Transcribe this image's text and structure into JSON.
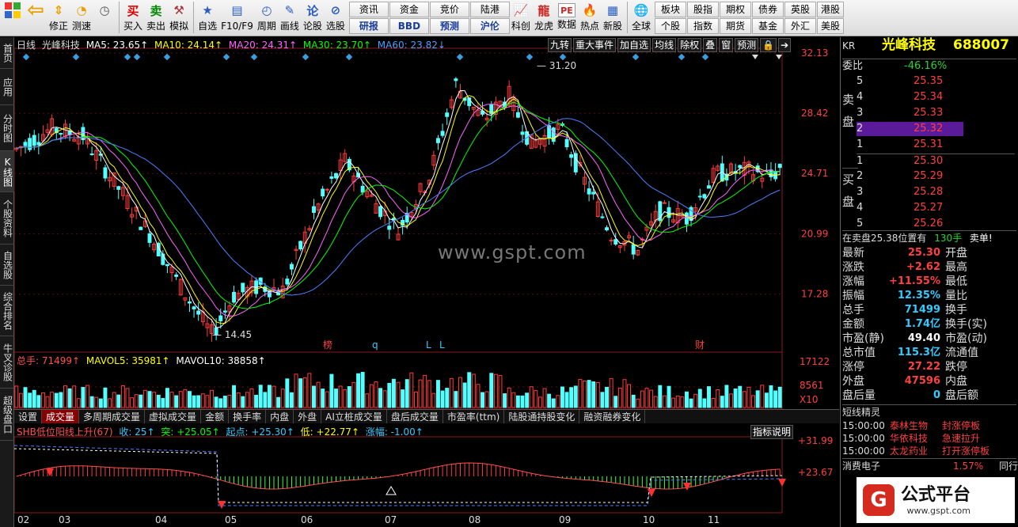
{
  "toolbar": {
    "buttons": [
      {
        "name": "home-icon",
        "label": ""
      },
      {
        "name": "back-arrow-icon",
        "label": ""
      },
      {
        "name": "fix-button",
        "label": "修正"
      },
      {
        "name": "test-speed-button",
        "label": "测速"
      },
      {
        "name": "buy-button",
        "icon": "买",
        "label": "买入"
      },
      {
        "name": "sell-button",
        "icon": "卖",
        "label": "卖出"
      },
      {
        "name": "simulate-button",
        "label": "模拟"
      },
      {
        "name": "watchlist-button",
        "label": "自选"
      },
      {
        "name": "f10-button",
        "label": "F10/F9"
      },
      {
        "name": "period-button",
        "label": "周期"
      },
      {
        "name": "draw-line-button",
        "label": "画线"
      },
      {
        "name": "forum-button",
        "label": "论股"
      },
      {
        "name": "stock-select-button",
        "label": "选股"
      }
    ],
    "grid1": [
      [
        "资讯",
        "研报"
      ],
      [
        "资金",
        "BBD"
      ],
      [
        "竞价",
        "预测"
      ],
      [
        "陆港",
        "沪伦"
      ]
    ],
    "icons2": [
      {
        "name": "kline-icon",
        "label": "科创"
      },
      {
        "name": "dragon-tiger-icon",
        "label": "龙虎"
      },
      {
        "name": "pe-icon",
        "icon": "PE",
        "label": "数据"
      },
      {
        "name": "hot-icon",
        "label": "热点"
      },
      {
        "name": "new-stock-icon",
        "label": "新股"
      },
      {
        "name": "globe-icon",
        "label": "全球"
      }
    ],
    "grid2": [
      [
        "板块",
        "个股"
      ],
      [
        "股指",
        "指数"
      ],
      [
        "期权",
        "期货"
      ],
      [
        "债券",
        "基金"
      ],
      [
        "英股",
        "外汇"
      ],
      [
        "港股",
        "美股"
      ]
    ]
  },
  "sidebar": [
    "首页",
    "应用",
    "分时图",
    "K线图",
    "个股资料",
    "自选股",
    "综合排名",
    "牛叉诊股",
    "超级盘口"
  ],
  "chart": {
    "header": {
      "period": "日线",
      "name": "光峰科技",
      "ma5": "MA5: 23.65↑",
      "ma10": "MA10: 24.14↑",
      "ma20": "MA20: 24.31↑",
      "ma30": "MA30: 23.70↑",
      "ma60": "MA60: 23.82↓"
    },
    "topbuttons": [
      "九转",
      "重大事件",
      "加自选",
      "均线",
      "除权",
      "叠",
      "窗",
      "预测"
    ],
    "price_axis": [
      "32.13",
      "28.42",
      "24.71",
      "20.99",
      "17.28"
    ],
    "high_label": "31.20",
    "low_label": "14.45",
    "event_marks": [
      "榜",
      "q",
      "L",
      "L",
      "财"
    ],
    "vol_header": {
      "total": "总手: 71499↑",
      "mavol5": "MAVOL5: 35981↑",
      "mavol10": "MAVOL10: 38858↑"
    },
    "vol_axis": [
      "17122",
      "8561",
      "X10"
    ],
    "subtabs": [
      "设置",
      "成交量",
      "多周期成交量",
      "虚拟成交量",
      "金额",
      "换手率",
      "内盘",
      "外盘",
      "AI立桩成交量",
      "盘后成交量",
      "市盈率(ttm)",
      "陆股通持股变化",
      "融资融券变化"
    ],
    "ind_header": {
      "name": "SHB低位阳线上升(67)",
      "shou": "收: 25↑",
      "tu": "突: +25.05↑",
      "qidian": "起点: +25.30↑",
      "di": "低: +22.77↑",
      "zhangfu": "涨幅: -1.00↑"
    },
    "ind_button": "指标说明",
    "ind_axis": [
      "+31.99",
      "+23.67"
    ],
    "months": [
      "02",
      "03",
      "04",
      "05",
      "06",
      "07",
      "08",
      "09",
      "10",
      "11"
    ],
    "watermark": "www.gspt.com"
  },
  "panel": {
    "code": "KR",
    "name": "光峰科技",
    "symbol": "688007",
    "weibi_label": "委比",
    "weibi": "-46.16%",
    "sell_side_label": [
      "卖",
      "盘"
    ],
    "buy_side_label": [
      "买",
      "盘"
    ],
    "asks": [
      {
        "n": "5",
        "p": "25.35"
      },
      {
        "n": "4",
        "p": "25.34"
      },
      {
        "n": "3",
        "p": "25.33"
      },
      {
        "n": "2",
        "p": "25.32"
      },
      {
        "n": "1",
        "p": "25.31"
      }
    ],
    "bids": [
      {
        "n": "1",
        "p": "25.30"
      },
      {
        "n": "2",
        "p": "25.29"
      },
      {
        "n": "3",
        "p": "25.28"
      },
      {
        "n": "4",
        "p": "25.27"
      },
      {
        "n": "5",
        "p": "25.26"
      }
    ],
    "order_info": {
      "text": "在卖盘25.38位置有",
      "qty": "130手",
      "tag": "卖单!"
    },
    "stats": [
      {
        "l": "最新",
        "v": "25.30",
        "r": "开盘",
        "c": "red"
      },
      {
        "l": "涨跌",
        "v": "+2.62",
        "r": "最高",
        "c": "red"
      },
      {
        "l": "涨幅",
        "v": "+11.55%",
        "r": "最低",
        "c": "red"
      },
      {
        "l": "振幅",
        "v": "12.35%",
        "r": "量比",
        "c": "cyan"
      },
      {
        "l": "总手",
        "v": "71499",
        "r": "换手",
        "c": "cyan"
      },
      {
        "l": "金额",
        "v": "1.74亿",
        "r": "换手(实)",
        "c": "cyan"
      },
      {
        "l": "市盈(静)",
        "v": "49.40",
        "r": "市盈(动)",
        "c": "white"
      },
      {
        "l": "总市值",
        "v": "115.3亿",
        "r": "流通值",
        "c": "cyan"
      },
      {
        "l": "涨停",
        "v": "27.22",
        "r": "跌停",
        "c": "red"
      },
      {
        "l": "外盘",
        "v": "47596",
        "r": "内盘",
        "c": "red"
      },
      {
        "l": "盘后量",
        "v": "0",
        "r": "盘后额",
        "c": "cyan"
      }
    ],
    "short_title": "短线精灵",
    "short_items": [
      {
        "t": "15:00:00",
        "s": "泰林生物",
        "e": "封涨停板"
      },
      {
        "t": "15:00:00",
        "s": "华依科技",
        "e": "急速拉升"
      },
      {
        "t": "15:00:00",
        "s": "太龙药业",
        "e": "打开涨停板"
      }
    ],
    "sector": {
      "name": "消费电子",
      "pct": "1.57%",
      "tab": "同行"
    },
    "logo_text": "公式平台",
    "logo_url": "www.gspt.com"
  },
  "colors": {
    "up": "#ff3c3c",
    "down": "#54ffff",
    "ma5": "#ffffff",
    "ma10": "#ffff00",
    "ma20": "#ff66ff",
    "ma30": "#00ff00",
    "ma60": "#4d7fff"
  }
}
